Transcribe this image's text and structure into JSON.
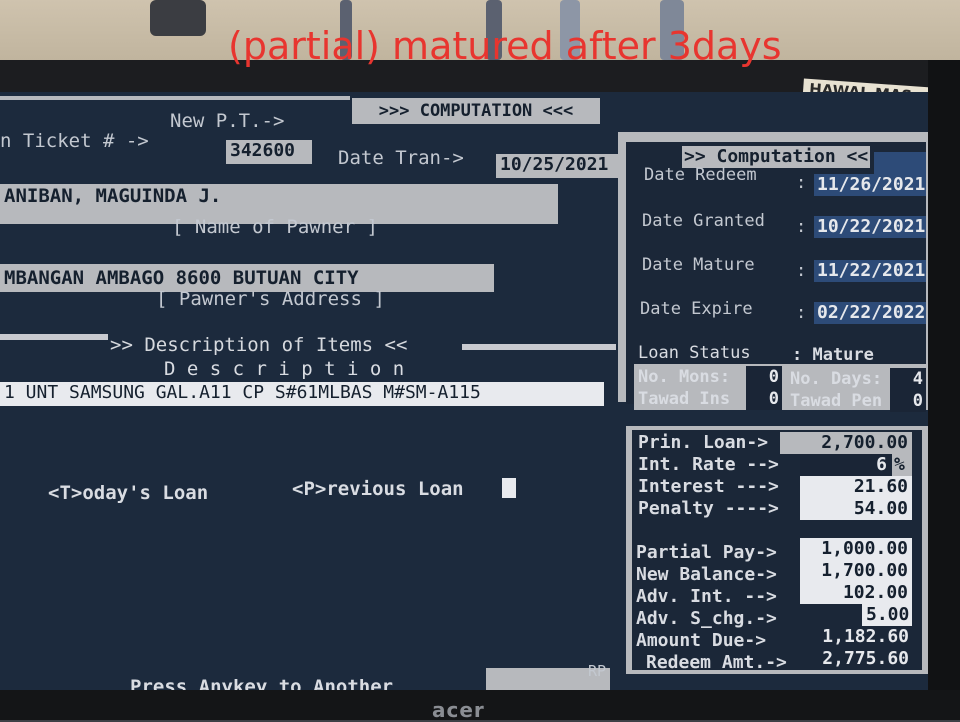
{
  "photo_caption": "(partial) matured after 3days",
  "tape_note": "HAWAL MAS ZERO \"O\"",
  "monitor_brand": "acer",
  "header": {
    "banner": ">>> COMPUTATION <<<",
    "new_pt_label": "New P.T.->",
    "ticket_label": "n Ticket # ->",
    "ticket_value": "342600",
    "date_tran_label": "Date Tran->",
    "date_tran_value": "10/25/2021"
  },
  "pawner": {
    "name": "ANIBAN, MAGUINDA J.",
    "name_caption": "[ Name of Pawner ]",
    "address": "MBANGAN AMBAGO 8600 BUTUAN CITY",
    "address_caption": "[ Pawner's Address ]"
  },
  "items": {
    "section_title": ">> Description of Items <<",
    "column_header": "D e s c r i p t i o n",
    "row1": "1 UNT SAMSUNG GAL.A11 CP S#61MLBAS M#SM-A115"
  },
  "options": {
    "todays_loan": "<T>oday's Loan",
    "previous_loan": "<P>revious Loan"
  },
  "footer": {
    "prompt": "Press Anykey to Another",
    "rp": "RP"
  },
  "computation": {
    "title": ">> Computation <<",
    "date_redeem_label": "Date Redeem",
    "date_redeem_value": "11/26/2021",
    "date_granted_label": "Date Granted",
    "date_granted_value": "10/22/2021",
    "date_mature_label": "Date Mature",
    "date_mature_value": "11/22/2021",
    "date_expire_label": "Date Expire",
    "date_expire_value": "02/22/2022",
    "colon": ":",
    "loan_status_label": "Loan Status",
    "loan_status_value": ": Mature",
    "no_mons_label": "No. Mons:",
    "no_mons_value": "0",
    "no_days_label": "No. Days:",
    "no_days_value": "4",
    "tawad_ins_label": "Tawad Ins",
    "tawad_ins_value": "0",
    "tawad_pen_label": "Tawad Pen",
    "tawad_pen_value": "0"
  },
  "amounts": {
    "prin_loan_label": "Prin. Loan->",
    "prin_loan_value": "2,700.00",
    "int_rate_label": "Int. Rate -->",
    "int_rate_value": "6",
    "int_rate_unit": "%",
    "interest_label": "Interest --->",
    "interest_value": "21.60",
    "penalty_label": "Penalty ---->",
    "penalty_value": "54.00",
    "partial_pay_label": "Partial Pay->",
    "partial_pay_value": "1,000.00",
    "new_balance_label": "New Balance->",
    "new_balance_value": "1,700.00",
    "adv_int_label": "Adv. Int. -->",
    "adv_int_value": "102.00",
    "adv_schg_label": "Adv. S_chg.->",
    "adv_schg_value": "5.00",
    "amount_due_label": "Amount Due->",
    "amount_due_value": "1,182.60",
    "redeem_amt_label": "Redeem Amt.->",
    "redeem_amt_value": "2,775.60"
  }
}
